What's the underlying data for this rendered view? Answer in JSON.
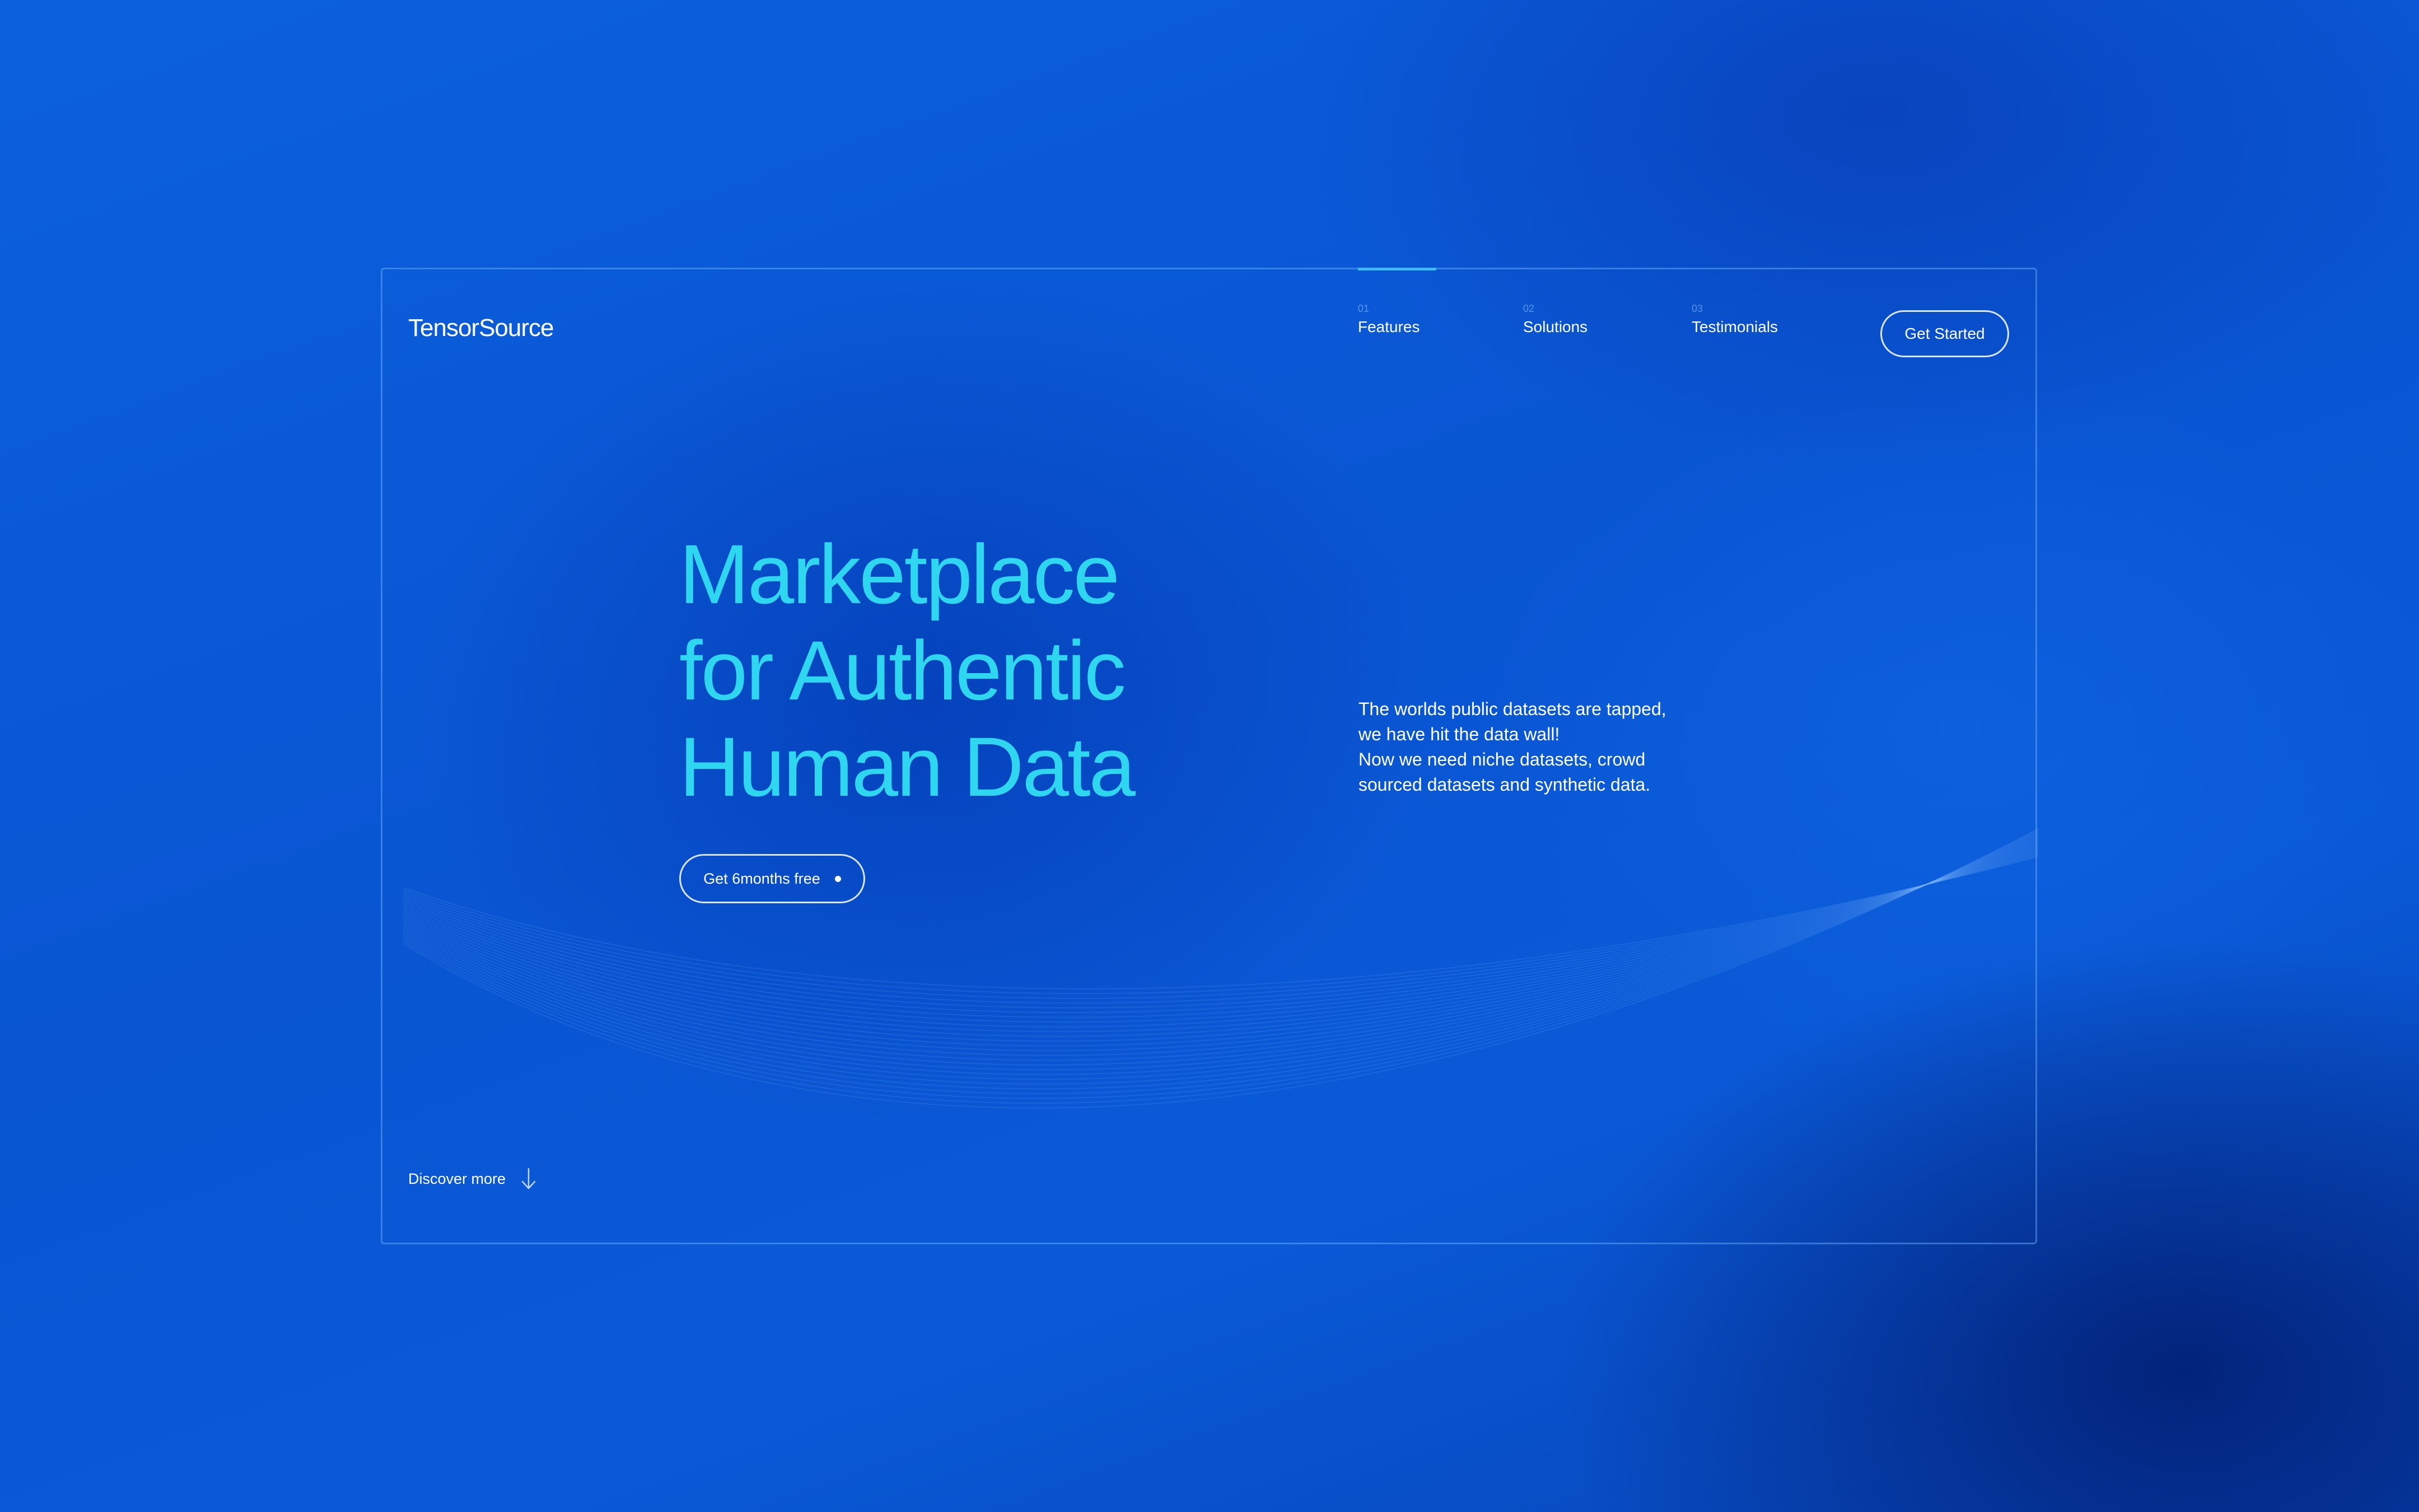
{
  "brand": {
    "name": "TensorSource"
  },
  "nav": {
    "items": [
      {
        "number": "01",
        "label": "Features"
      },
      {
        "number": "02",
        "label": "Solutions"
      },
      {
        "number": "03",
        "label": "Testimonials"
      }
    ],
    "cta_label": "Get Started"
  },
  "hero": {
    "headline": [
      "Marketplace",
      "for Authentic",
      "Human Data"
    ],
    "cta_label": "Get 6months free",
    "description": [
      "The worlds public datasets are tapped,",
      "we have hit the data wall!",
      "Now we need niche datasets, crowd",
      "sourced datasets and synthetic data."
    ]
  },
  "footer": {
    "discover_label": "Discover more",
    "discover_icon": "arrow-down-icon"
  },
  "colors": {
    "background": "#0a5ad8",
    "headline": "#2fd6ef",
    "accent": "#3fb8ff",
    "text": "#ffffff"
  }
}
